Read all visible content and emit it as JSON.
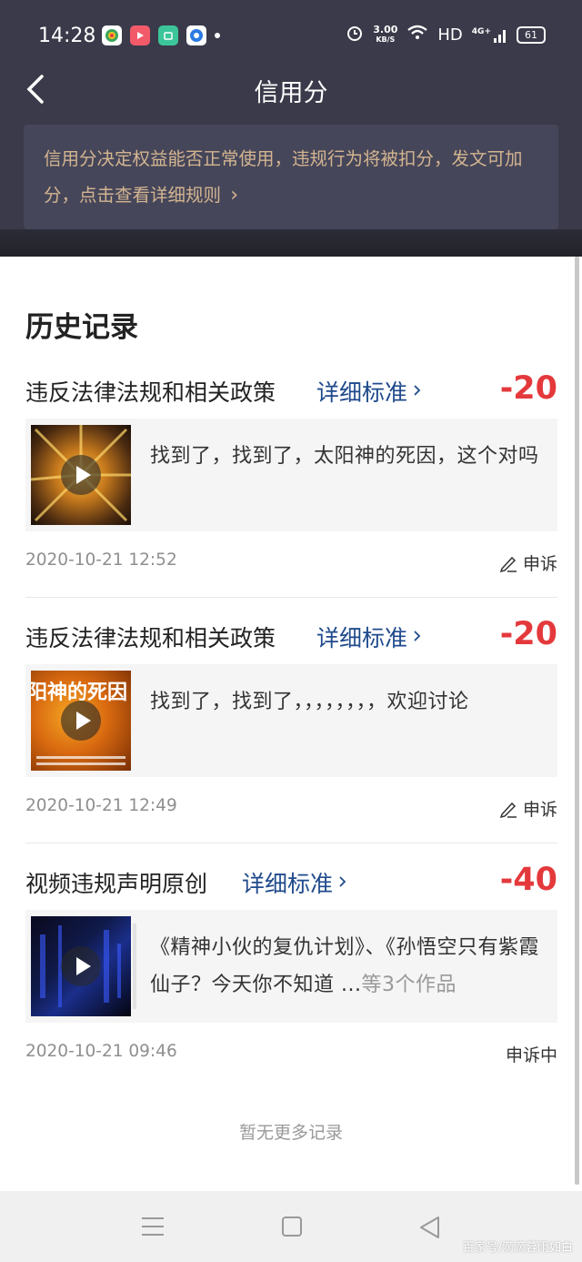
{
  "status_bar": {
    "time": "14:28",
    "speed_value": "3.00",
    "speed_unit": "KB/S",
    "hd": "HD",
    "network": "4G+",
    "battery": "61"
  },
  "header": {
    "title": "信用分"
  },
  "notice": {
    "text": "信用分决定权益能否正常使用，违规行为将被扣分，发文可加分，点击查看详细规则",
    "chevron": "›"
  },
  "history": {
    "title": "历史记录",
    "standard_label": "详细标准",
    "records": [
      {
        "reason": "违反法律法规和相关政策",
        "score": "-20",
        "content": "找到了，找到了，太阳神的死因，这个对吗",
        "more": "",
        "date": "2020-10-21 12:52",
        "action": "申诉"
      },
      {
        "reason": "违反法律法规和相关政策",
        "score": "-20",
        "content": "找到了，找到了，，，，，，，，欢迎讨论",
        "more": "",
        "date": "2020-10-21 12:49",
        "action": "申诉"
      },
      {
        "reason": "视频违规声明原创",
        "score": "-40",
        "content": "《精神小伙的复仇计划》、《孙悟空只有紫霞仙子？今天你不知道 ...",
        "more": "等3个作品",
        "date": "2020-10-21 09:46",
        "action": "申诉中"
      }
    ],
    "thumb2_caption": "阳神的死因"
  },
  "footer": {
    "no_more": "暂无更多记录"
  },
  "watermark": "百家号/滴滴暮雨如白",
  "colors": {
    "header_bg": "#3a3a4a",
    "notice_text": "#d3b590",
    "score_red": "#e4393c",
    "link_blue": "#1f4a8c"
  }
}
